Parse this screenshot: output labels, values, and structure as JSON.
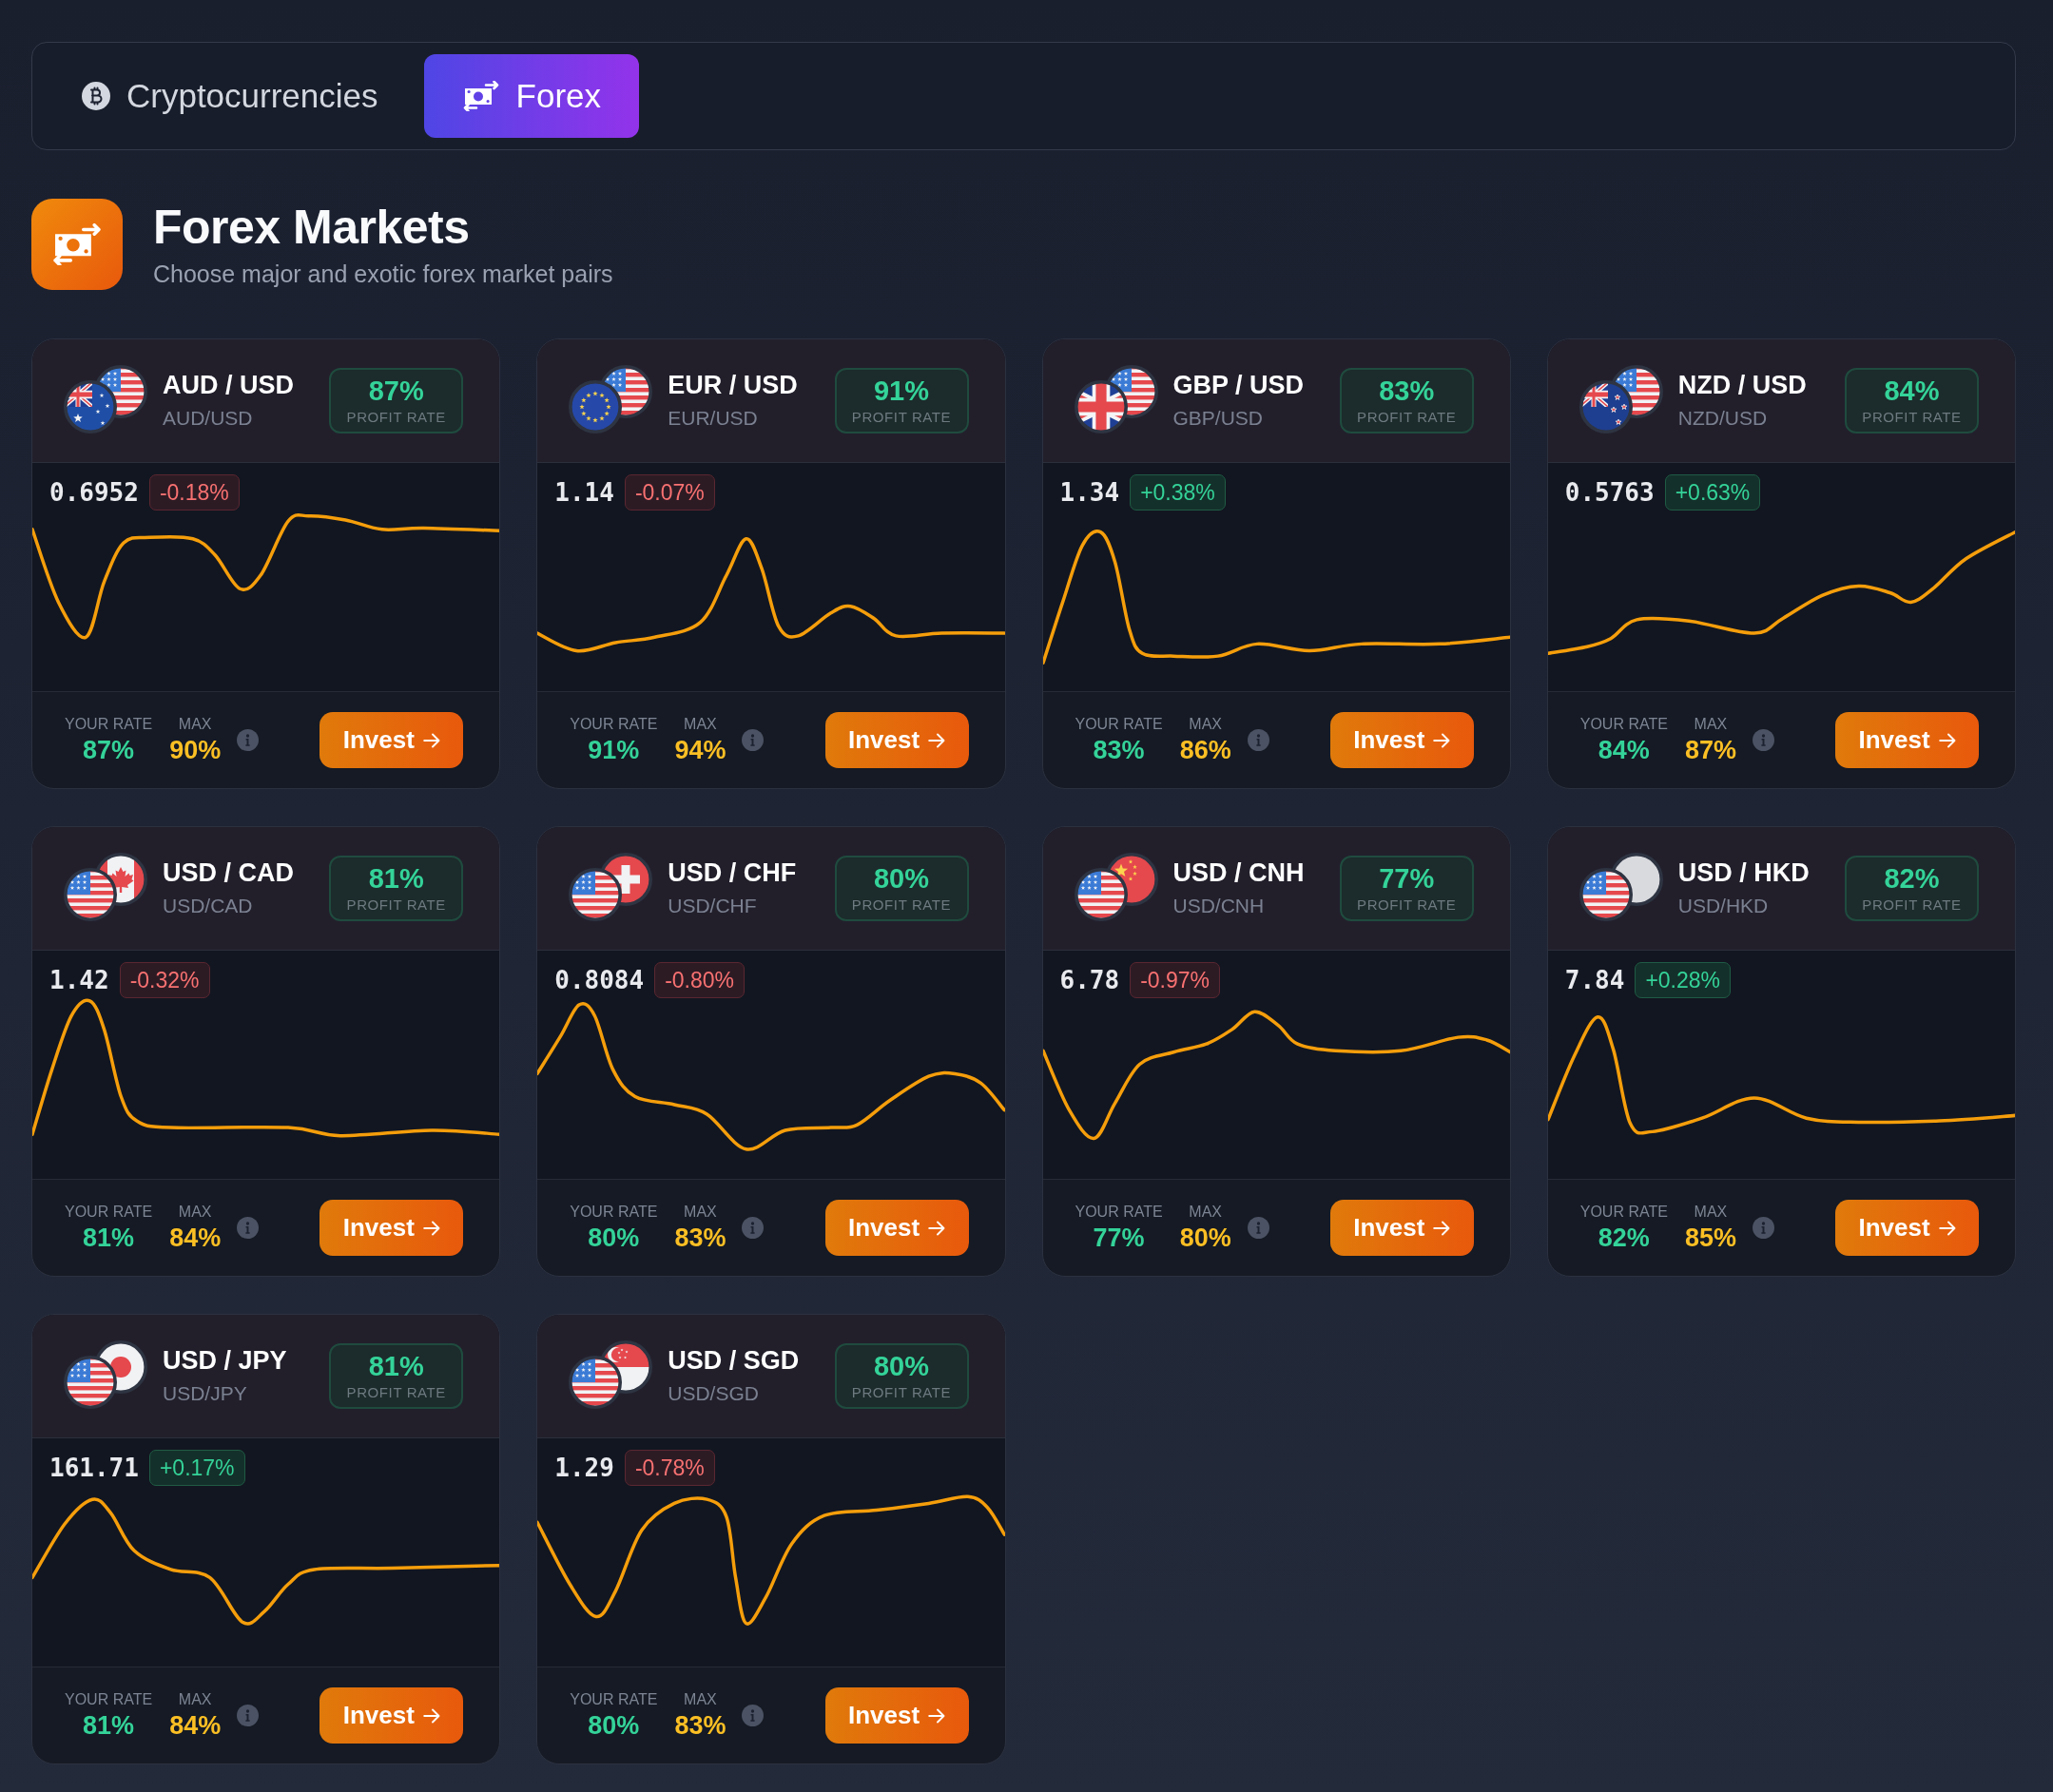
{
  "tabs": [
    {
      "label": "Cryptocurrencies",
      "kind": "coin",
      "selected": false
    },
    {
      "label": "Forex",
      "kind": "cash",
      "selected": true
    }
  ],
  "section": {
    "title": "Forex Markets",
    "subtitle": "Choose major and exotic forex market pairs"
  },
  "pairs": [
    {
      "name": "AUD / USD",
      "symbol": "AUD/USD",
      "flags": [
        {
          "kind": "australia"
        },
        {
          "kind": "usa"
        }
      ],
      "profit": "87%",
      "profit_label": "PROFIT RATE",
      "price": "0.6952",
      "change": "-0.18%",
      "rising": false,
      "your_rate_label": "YOUR RATE",
      "your_rate": "87%",
      "max_label": "MAX",
      "max": "90%",
      "button": "Invest"
    },
    {
      "name": "EUR / USD",
      "symbol": "EUR/USD",
      "flags": [
        {
          "kind": "eu"
        },
        {
          "kind": "usa"
        }
      ],
      "profit": "91%",
      "profit_label": "PROFIT RATE",
      "price": "1.14",
      "change": "-0.07%",
      "rising": false,
      "your_rate_label": "YOUR RATE",
      "your_rate": "91%",
      "max_label": "MAX",
      "max": "94%",
      "button": "Invest"
    },
    {
      "name": "GBP / USD",
      "symbol": "GBP/USD",
      "flags": [
        {
          "kind": "uk"
        },
        {
          "kind": "usa"
        }
      ],
      "profit": "83%",
      "profit_label": "PROFIT RATE",
      "price": "1.34",
      "change": "+0.38%",
      "rising": true,
      "your_rate_label": "YOUR RATE",
      "your_rate": "83%",
      "max_label": "MAX",
      "max": "86%",
      "button": "Invest"
    },
    {
      "name": "NZD / USD",
      "symbol": "NZD/USD",
      "flags": [
        {
          "kind": "new_zealand"
        },
        {
          "kind": "usa"
        }
      ],
      "profit": "84%",
      "profit_label": "PROFIT RATE",
      "price": "0.5763",
      "change": "+0.63%",
      "rising": true,
      "your_rate_label": "YOUR RATE",
      "your_rate": "84%",
      "max_label": "MAX",
      "max": "87%",
      "button": "Invest"
    },
    {
      "name": "USD / CAD",
      "symbol": "USD/CAD",
      "flags": [
        {
          "kind": "usa"
        },
        {
          "kind": "canada"
        }
      ],
      "profit": "81%",
      "profit_label": "PROFIT RATE",
      "price": "1.42",
      "change": "-0.32%",
      "rising": false,
      "your_rate_label": "YOUR RATE",
      "your_rate": "81%",
      "max_label": "MAX",
      "max": "84%",
      "button": "Invest"
    },
    {
      "name": "USD / CHF",
      "symbol": "USD/CHF",
      "flags": [
        {
          "kind": "usa"
        },
        {
          "kind": "switzerland"
        }
      ],
      "profit": "80%",
      "profit_label": "PROFIT RATE",
      "price": "0.8084",
      "change": "-0.80%",
      "rising": false,
      "your_rate_label": "YOUR RATE",
      "your_rate": "80%",
      "max_label": "MAX",
      "max": "83%",
      "button": "Invest"
    },
    {
      "name": "USD / CNH",
      "symbol": "USD/CNH",
      "flags": [
        {
          "kind": "usa"
        },
        {
          "kind": "china"
        }
      ],
      "profit": "77%",
      "profit_label": "PROFIT RATE",
      "price": "6.78",
      "change": "-0.97%",
      "rising": false,
      "your_rate_label": "YOUR RATE",
      "your_rate": "77%",
      "max_label": "MAX",
      "max": "80%",
      "button": "Invest"
    },
    {
      "name": "USD / HKD",
      "symbol": "USD/HKD",
      "flags": [
        {
          "kind": "usa"
        },
        {
          "kind": "blank"
        }
      ],
      "profit": "82%",
      "profit_label": "PROFIT RATE",
      "price": "7.84",
      "change": "+0.28%",
      "rising": true,
      "your_rate_label": "YOUR RATE",
      "your_rate": "82%",
      "max_label": "MAX",
      "max": "85%",
      "button": "Invest"
    },
    {
      "name": "USD / JPY",
      "symbol": "USD/JPY",
      "flags": [
        {
          "kind": "usa"
        },
        {
          "kind": "japan"
        }
      ],
      "profit": "81%",
      "profit_label": "PROFIT RATE",
      "price": "161.71",
      "change": "+0.17%",
      "rising": true,
      "your_rate_label": "YOUR RATE",
      "your_rate": "81%",
      "max_label": "MAX",
      "max": "84%",
      "button": "Invest"
    },
    {
      "name": "USD / SGD",
      "symbol": "USD/SGD",
      "flags": [
        {
          "kind": "usa"
        },
        {
          "kind": "singapore"
        }
      ],
      "profit": "80%",
      "profit_label": "PROFIT RATE",
      "price": "1.29",
      "change": "-0.78%",
      "rising": false,
      "your_rate_label": "YOUR RATE",
      "your_rate": "80%",
      "max_label": "MAX",
      "max": "83%",
      "button": "Invest"
    }
  ]
}
